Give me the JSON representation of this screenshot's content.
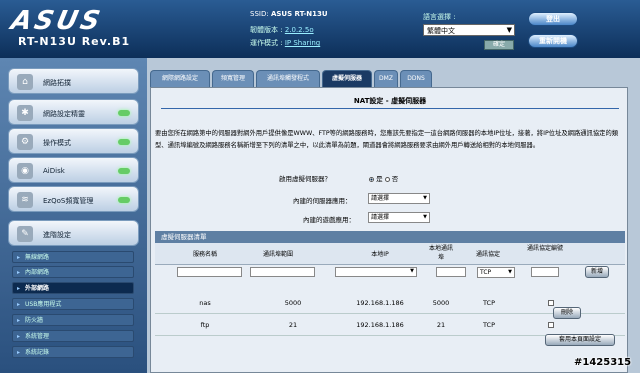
{
  "header": {
    "logo": "ASUS",
    "model": "RT-N13U Rev.B1",
    "ssid_label": "SSID:",
    "ssid_value": "ASUS RT-N13U",
    "fw_label": "韌體版本 :",
    "fw_value": "2.0.2.5o",
    "mode_label": "運作模式 :",
    "mode_value": "IP Sharing",
    "lang_label": "語言選擇 :",
    "lang_value": "繁體中文",
    "apply_label": "確定",
    "logout_label": "登出",
    "reboot_label": "重新開機"
  },
  "sidebar": {
    "items": [
      {
        "label": "網路拓撲",
        "icon": "network-map-icon",
        "led": false
      },
      {
        "label": "網路設定精靈",
        "icon": "network-wizard-icon",
        "led": true
      },
      {
        "label": "操作模式",
        "icon": "operation-mode-icon",
        "led": true
      },
      {
        "label": "AiDisk",
        "icon": "aidisk-icon",
        "led": true
      },
      {
        "label": "EzQoS頻寬管理",
        "icon": "ezqos-icon",
        "led": true
      },
      {
        "label": "進階設定",
        "icon": "advanced-settings-icon",
        "led": false
      }
    ],
    "subitems": [
      {
        "label": "無線網路",
        "active": false
      },
      {
        "label": "內部網路",
        "active": false
      },
      {
        "label": "外部網路",
        "active": true
      },
      {
        "label": "USB應用程式",
        "active": false
      },
      {
        "label": "防火牆",
        "active": false
      },
      {
        "label": "系統管理",
        "active": false
      },
      {
        "label": "系統記錄",
        "active": false
      }
    ]
  },
  "tabs": [
    {
      "label": "網際網路設定",
      "active": false
    },
    {
      "label": "頻寬管理",
      "active": false
    },
    {
      "label": "通訊埠觸發程式",
      "active": false
    },
    {
      "label": "虛擬伺服器",
      "active": true
    },
    {
      "label": "DMZ",
      "active": false
    },
    {
      "label": "DDNS",
      "active": false
    }
  ],
  "main": {
    "title": "NAT設定 - 虛擬伺服器",
    "description": "要由您所在網路第中的伺服器對網外用戶提供像是WWW、FTP等的網路服務時，您應該先要指定一這台網路伺服器的本地IP位址，接著，將IP位址及網路通訊協定的類型、通訊埠編號及網路服務名稱新增至下列的清單之中，以此清單為前題，閘道器會將網路服務要求由網外用戶轉送給相對的本地伺服器。",
    "enable_label": "啟用虛擬伺服器？",
    "enable_yes": "是",
    "enable_no": "否",
    "enable_value": "yes",
    "builtin_server_label": "內建的伺服器應用：",
    "builtin_server_value": "請選擇",
    "builtin_game_label": "內建的遊戲應用：",
    "builtin_game_value": "請選擇",
    "list_title": "虛擬伺服器清單",
    "columns": [
      "服務名稱",
      "通訊埠範圍",
      "本地IP",
      "本地通訊埠",
      "通訊協定",
      "通訊協定編號"
    ],
    "protocol_default": "TCP",
    "add_label": "新增",
    "delete_label": "刪除",
    "apply_label": "套用本頁面設定",
    "rows": [
      {
        "name": "nas",
        "port_range": "5000",
        "local_ip": "192.168.1.186",
        "local_port": "5000",
        "protocol": "TCP"
      },
      {
        "name": "ftp",
        "port_range": "21",
        "local_ip": "192.168.1.186",
        "local_port": "21",
        "protocol": "TCP"
      }
    ]
  },
  "watermark": "#1425315"
}
